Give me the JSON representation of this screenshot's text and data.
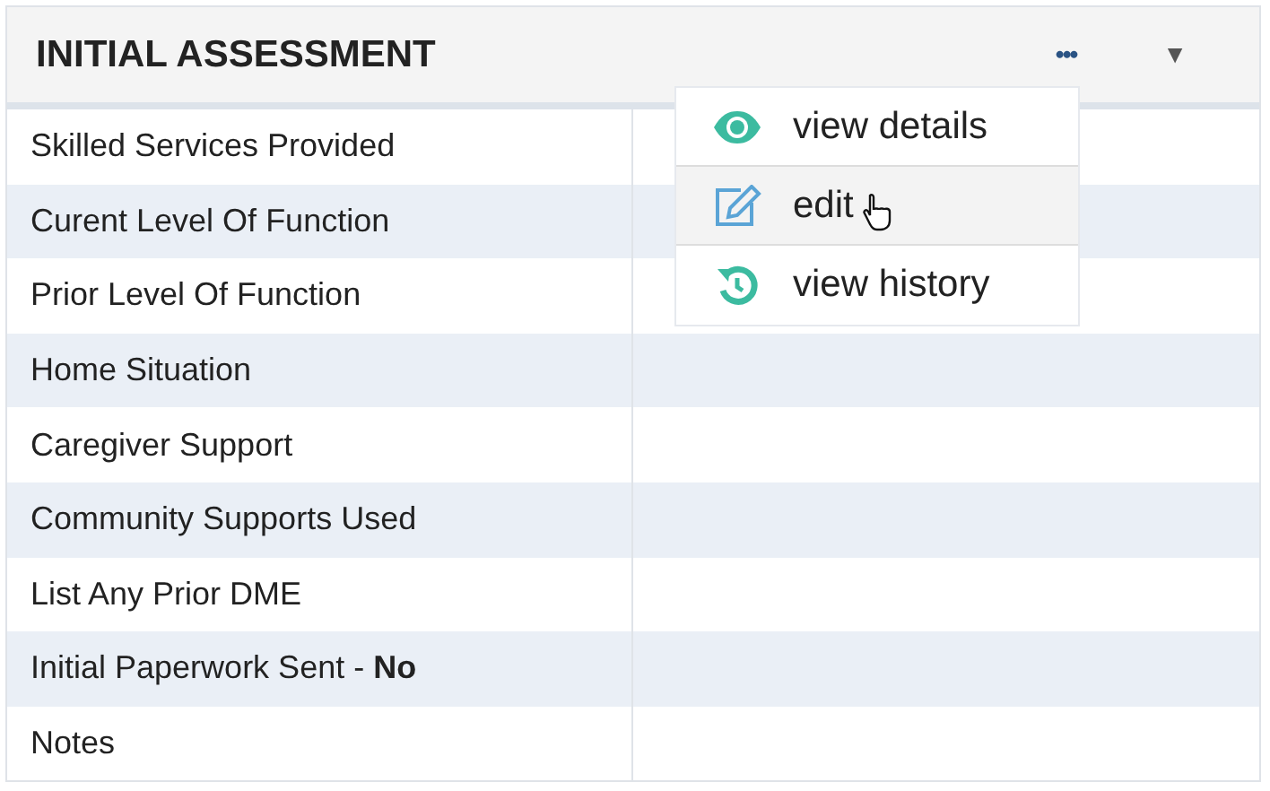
{
  "panel": {
    "title": "INITIAL ASSESSMENT",
    "more_button": "•••",
    "collapse_button": "▼"
  },
  "rows": [
    {
      "label": "Skilled Services Provided"
    },
    {
      "label": "Curent Level Of Function"
    },
    {
      "label": "Prior Level Of Function"
    },
    {
      "label": "Home Situation"
    },
    {
      "label": "Caregiver Support"
    },
    {
      "label": "Community Supports Used"
    },
    {
      "label": "List Any Prior DME"
    },
    {
      "label": "Initial Paperwork Sent - **No**"
    },
    {
      "label": "Notes"
    }
  ],
  "menu": {
    "items": [
      {
        "label": "view details",
        "kind": "view",
        "hovered": false
      },
      {
        "label": "edit",
        "kind": "edit",
        "hovered": true
      },
      {
        "label": "view history",
        "kind": "history",
        "hovered": false
      }
    ]
  }
}
